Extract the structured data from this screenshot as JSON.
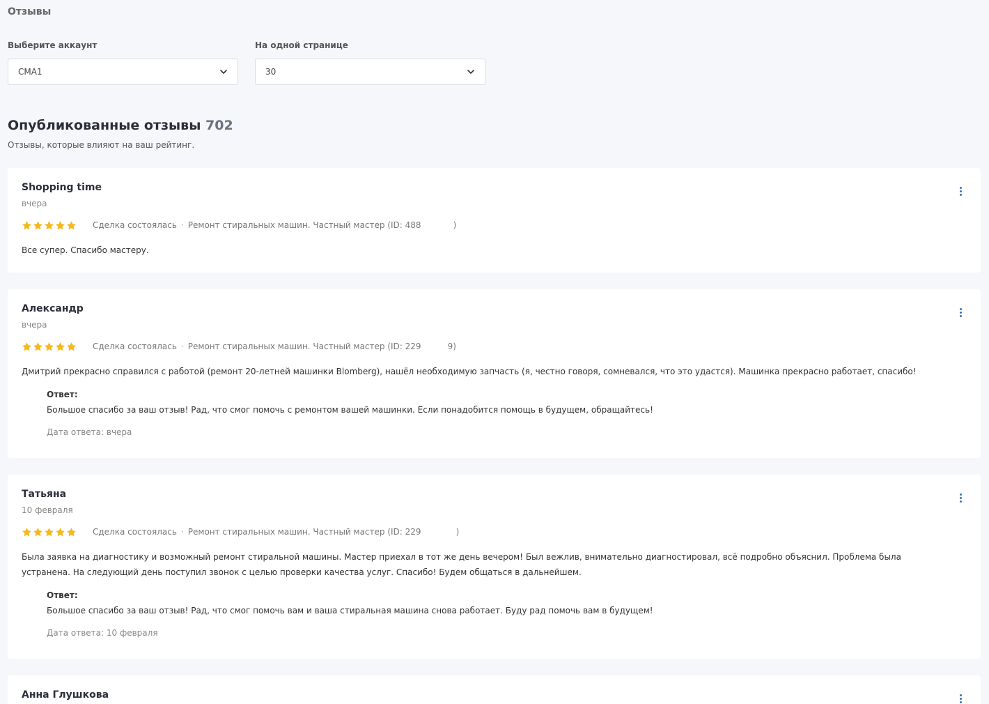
{
  "header": {
    "title": "Отзывы"
  },
  "filters": {
    "account_label": "Выберите аккаунт",
    "account_value": "CMA1",
    "per_page_label": "На одной странице",
    "per_page_value": "30"
  },
  "section": {
    "title": "Опубликованные отзывы",
    "count": "702",
    "subtitle": "Отзывы, которые влияют на ваш рейтинг."
  },
  "colors": {
    "star": "#f5b91d",
    "menu": "#3b6fb6"
  },
  "reviews": [
    {
      "author": "Shopping time",
      "date": "вчера",
      "rating": 5,
      "status": "Сделка состоялась",
      "service_prefix": "Ремонт стиральных машин. Частный мастер (ID: 488",
      "service_suffix": ")",
      "text": "Все супер. Спасибо мастеру."
    },
    {
      "author": "Александр",
      "date": "вчера",
      "rating": 5,
      "status": "Сделка состоялась",
      "service_prefix": "Ремонт стиральных машин. Частный мастер (ID: 229",
      "service_suffix": "9)",
      "text": "Дмитрий прекрасно справился с работой (ремонт 20-летней машинки Blomberg), нашёл необходимую запчасть (я, честно говоря, сомневался, что это удастся). Машинка прекрасно работает, спасибо!",
      "answer_label": "Ответ:",
      "answer": "Большое спасибо за ваш отзыв! Рад, что смог помочь с ремонтом вашей машинки. Если понадобится помощь в будущем, обращайтесь!",
      "answer_date": "Дата ответа: вчера"
    },
    {
      "author": "Татьяна",
      "date": "10 февраля",
      "rating": 5,
      "status": "Сделка состоялась",
      "service_prefix": "Ремонт стиральных машин. Частный мастер (ID: 229",
      "service_suffix": ")",
      "text": "Была заявка на диагностику и возможный ремонт стиральной машины. Мастер приехал в тот же день вечером! Был вежлив, внимательно диагностировал, всё подробно объяснил. Проблема была устранена. На следующий день поступил звонок с целью проверки качества услуг. Спасибо! Будем общаться в дальнейшем.",
      "answer_label": "Ответ:",
      "answer": "Большое спасибо за ваш отзыв! Рад, что смог помочь вам и ваша стиральная машина снова работает. Буду рад помочь вам в будущем!",
      "answer_date": "Дата ответа: 10 февраля"
    },
    {
      "author": "Анна Глушкова"
    }
  ]
}
